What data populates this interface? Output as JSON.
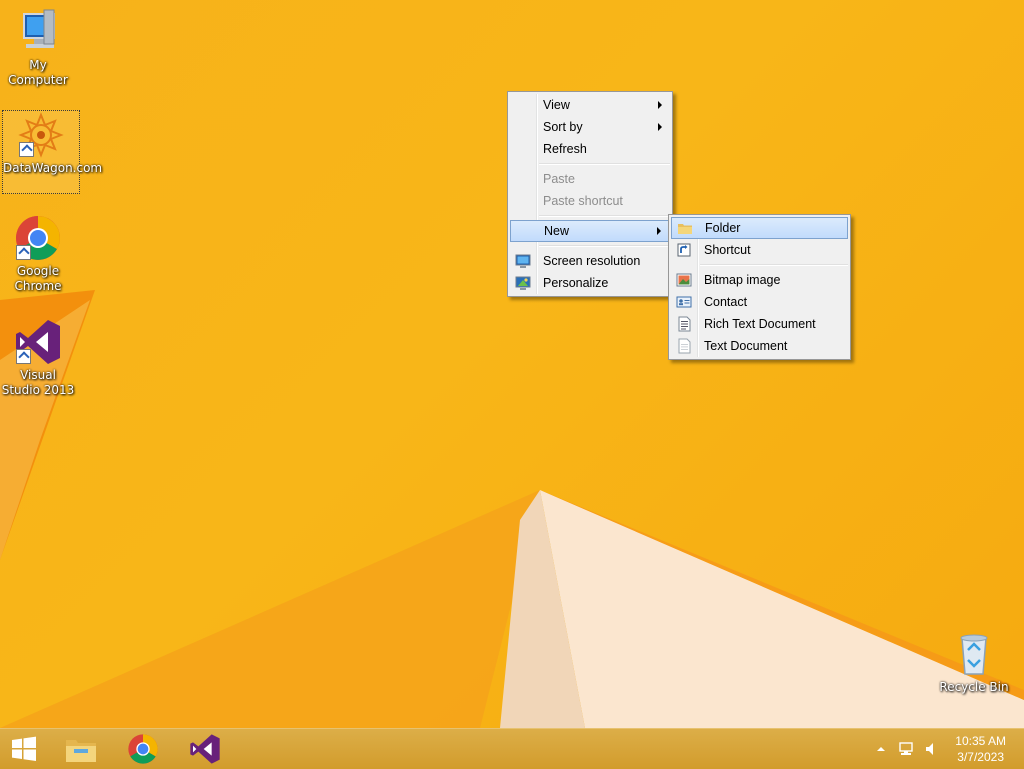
{
  "desktop_icons": [
    {
      "label": "My Computer",
      "icon": "my-computer-icon"
    },
    {
      "label": "DataWagon.com",
      "icon": "datawagon-icon"
    },
    {
      "label": "Google Chrome",
      "icon": "chrome-icon"
    },
    {
      "label": "Visual Studio 2013",
      "icon": "visual-studio-icon"
    },
    {
      "label": "Recycle Bin",
      "icon": "recycle-bin-icon"
    }
  ],
  "context_menu": {
    "items": [
      {
        "label": "View",
        "has_submenu": true
      },
      {
        "label": "Sort by",
        "has_submenu": true
      },
      {
        "label": "Refresh"
      },
      {
        "label": "Paste",
        "disabled": true
      },
      {
        "label": "Paste shortcut",
        "disabled": true
      },
      {
        "label": "New",
        "has_submenu": true,
        "highlighted": true
      },
      {
        "label": "Screen resolution",
        "icon": "screen-resolution-icon"
      },
      {
        "label": "Personalize",
        "icon": "personalize-icon"
      }
    ]
  },
  "new_submenu": {
    "items": [
      {
        "label": "Folder",
        "icon": "folder-icon",
        "highlighted": true
      },
      {
        "label": "Shortcut",
        "icon": "shortcut-icon"
      },
      {
        "label": "Bitmap image",
        "icon": "bitmap-icon"
      },
      {
        "label": "Contact",
        "icon": "contact-icon"
      },
      {
        "label": "Rich Text Document",
        "icon": "rich-text-icon"
      },
      {
        "label": "Text Document",
        "icon": "text-document-icon"
      }
    ]
  },
  "taskbar": {
    "pinned": [
      "file-explorer-icon",
      "chrome-icon",
      "visual-studio-icon"
    ],
    "clock_time": "10:35 AM",
    "clock_date": "3/7/2023"
  },
  "colors": {
    "wallpaper": "#f7b21a",
    "taskbar": "#d8a63a",
    "menu_background": "#f0f0f0",
    "menu_highlight": "#cce4fc"
  }
}
